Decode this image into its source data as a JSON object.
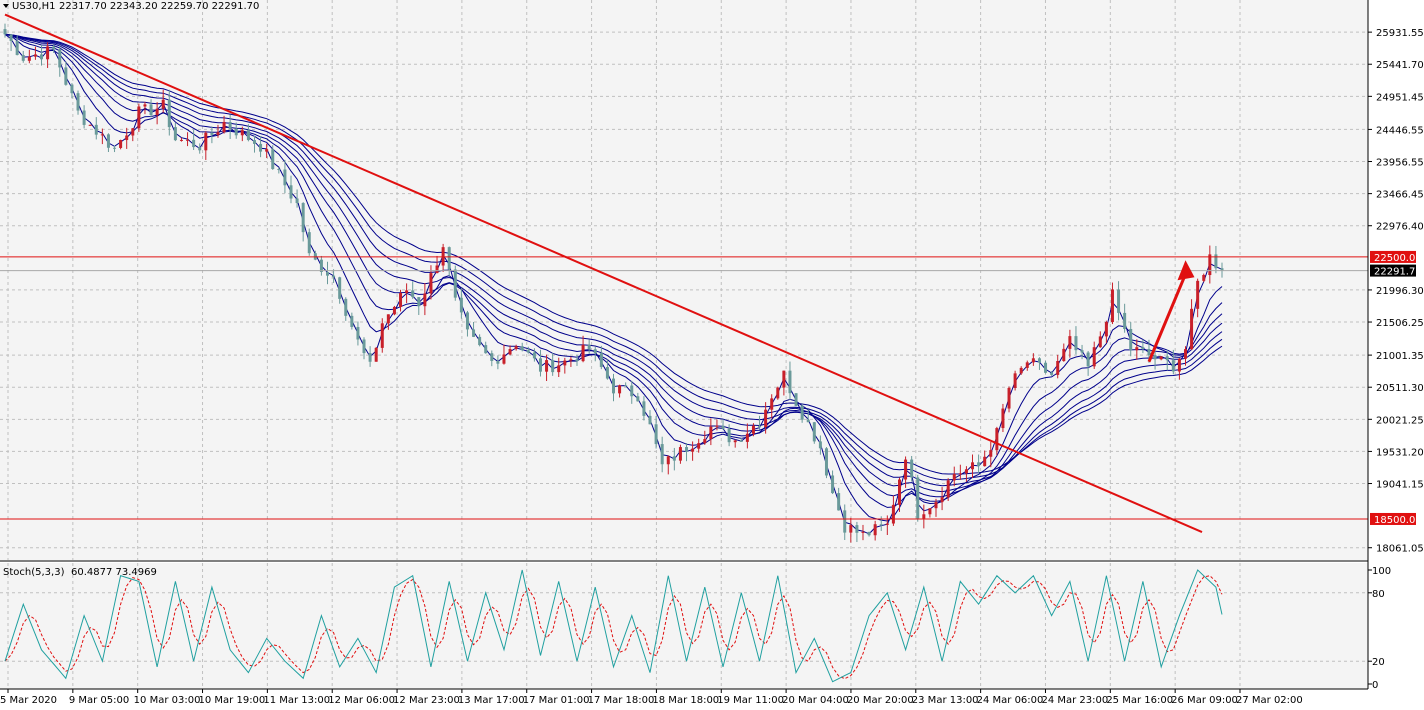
{
  "header": {
    "symbol_label": "US30,H1",
    "ohlc": "22317.70 22343.20 22259.70 22291.70",
    "menu_arrow_icon": "triangle-down-icon"
  },
  "indicator_header": {
    "label": "Stoch(5,3,3)",
    "values": "60.4877 73.4969"
  },
  "colors": {
    "background": "#f4f4f4",
    "grid": "#c0c0c0",
    "bull": "#c8202a",
    "bear": "#6a9a9a",
    "ma": "#00008b",
    "trendline": "#e01010",
    "hline": "#e01010",
    "stoch_main": "#20a0a0",
    "stoch_signal": "#e01010",
    "price_tag_current": "#000000"
  },
  "chart_data": [
    {
      "type": "candlestick",
      "symbol": "US30",
      "timeframe": "H1",
      "y_ticks": [
        "25931.55",
        "25441.70",
        "24951.45",
        "24446.55",
        "23956.55",
        "23466.45",
        "22976.40",
        "21996.30",
        "21506.25",
        "21001.35",
        "20511.30",
        "20021.25",
        "19531.20",
        "19041.15",
        "18061.05"
      ],
      "ylim": [
        17950,
        26300
      ],
      "x_ticks": [
        "5 Mar 2020",
        "9 Mar 05:00",
        "10 Mar 03:00",
        "10 Mar 19:00",
        "11 Mar 13:00",
        "12 Mar 06:00",
        "12 Mar 23:00",
        "13 Mar 17:00",
        "17 Mar 01:00",
        "17 Mar 18:00",
        "18 Mar 18:00",
        "19 Mar 11:00",
        "20 Mar 04:00",
        "20 Mar 20:00",
        "23 Mar 13:00",
        "24 Mar 06:00",
        "24 Mar 23:00",
        "25 Mar 16:00",
        "26 Mar 09:00",
        "27 Mar 02:00"
      ],
      "close_path": [
        [
          0,
          25900
        ],
        [
          3,
          25550
        ],
        [
          8,
          25650
        ],
        [
          12,
          24700
        ],
        [
          18,
          24150
        ],
        [
          22,
          24700
        ],
        [
          26,
          24800
        ],
        [
          28,
          24300
        ],
        [
          32,
          24200
        ],
        [
          36,
          24550
        ],
        [
          42,
          24200
        ],
        [
          48,
          23300
        ],
        [
          50,
          22500
        ],
        [
          54,
          22200
        ],
        [
          58,
          21200
        ],
        [
          60,
          20800
        ],
        [
          62,
          21500
        ],
        [
          66,
          22000
        ],
        [
          68,
          21800
        ],
        [
          70,
          22200
        ],
        [
          72,
          22700
        ],
        [
          74,
          21800
        ],
        [
          76,
          21300
        ],
        [
          80,
          20900
        ],
        [
          84,
          21200
        ],
        [
          88,
          20800
        ],
        [
          92,
          20900
        ],
        [
          96,
          21100
        ],
        [
          100,
          20500
        ],
        [
          104,
          20400
        ],
        [
          106,
          19900
        ],
        [
          108,
          19300
        ],
        [
          112,
          19600
        ],
        [
          116,
          19900
        ],
        [
          120,
          19700
        ],
        [
          124,
          20000
        ],
        [
          126,
          20400
        ],
        [
          128,
          20700
        ],
        [
          130,
          20300
        ],
        [
          134,
          19600
        ],
        [
          136,
          18900
        ],
        [
          138,
          18400
        ],
        [
          141,
          18250
        ],
        [
          145,
          18400
        ],
        [
          148,
          19500
        ],
        [
          150,
          18600
        ],
        [
          153,
          18800
        ],
        [
          156,
          19200
        ],
        [
          160,
          19300
        ],
        [
          163,
          19800
        ],
        [
          165,
          20500
        ],
        [
          168,
          20900
        ],
        [
          172,
          20700
        ],
        [
          175,
          21200
        ],
        [
          178,
          20800
        ],
        [
          180,
          21300
        ],
        [
          182,
          21900
        ],
        [
          185,
          21100
        ],
        [
          188,
          21000
        ],
        [
          190,
          20900
        ],
        [
          192,
          20850
        ],
        [
          194,
          21100
        ],
        [
          196,
          22100
        ],
        [
          198,
          22500
        ],
        [
          200,
          22300
        ]
      ],
      "close": 22291.7,
      "candle_count": 201,
      "trendline": {
        "from": [
          0,
          26200
        ],
        "to": [
          200,
          18300
        ]
      },
      "horizontal_lines": [
        22500,
        18500
      ],
      "price_tags": [
        {
          "label": "22500.00",
          "value": 22500,
          "style": "red"
        },
        {
          "label": "22291.70",
          "value": 22291.7,
          "style": "black"
        },
        {
          "label": "18500.00",
          "value": 18500,
          "style": "red"
        }
      ],
      "arrow": {
        "from": [
          188,
          20900
        ],
        "to": [
          194,
          22450
        ]
      },
      "ma_offsets": [
        0,
        60,
        120,
        180,
        240,
        300,
        380,
        460
      ],
      "grid": true
    },
    {
      "type": "line",
      "name": "Stoch(5,3,3)",
      "ylim": [
        0,
        100
      ],
      "y_ticks": [
        "100",
        "80",
        "20",
        "0"
      ],
      "levels": [
        80,
        20
      ],
      "main_path": [
        [
          0,
          20
        ],
        [
          3,
          70
        ],
        [
          6,
          30
        ],
        [
          10,
          5
        ],
        [
          13,
          60
        ],
        [
          16,
          20
        ],
        [
          19,
          95
        ],
        [
          22,
          90
        ],
        [
          25,
          15
        ],
        [
          28,
          90
        ],
        [
          31,
          20
        ],
        [
          34,
          85
        ],
        [
          37,
          30
        ],
        [
          40,
          10
        ],
        [
          43,
          40
        ],
        [
          46,
          20
        ],
        [
          49,
          5
        ],
        [
          52,
          60
        ],
        [
          55,
          15
        ],
        [
          58,
          40
        ],
        [
          61,
          10
        ],
        [
          64,
          85
        ],
        [
          67,
          95
        ],
        [
          70,
          15
        ],
        [
          73,
          90
        ],
        [
          76,
          20
        ],
        [
          79,
          80
        ],
        [
          82,
          30
        ],
        [
          85,
          100
        ],
        [
          88,
          25
        ],
        [
          91,
          90
        ],
        [
          94,
          20
        ],
        [
          97,
          85
        ],
        [
          100,
          15
        ],
        [
          103,
          60
        ],
        [
          106,
          10
        ],
        [
          109,
          95
        ],
        [
          112,
          20
        ],
        [
          115,
          85
        ],
        [
          118,
          15
        ],
        [
          121,
          80
        ],
        [
          124,
          20
        ],
        [
          127,
          95
        ],
        [
          130,
          10
        ],
        [
          133,
          40
        ],
        [
          136,
          2
        ],
        [
          139,
          10
        ],
        [
          142,
          60
        ],
        [
          145,
          80
        ],
        [
          148,
          30
        ],
        [
          151,
          85
        ],
        [
          154,
          20
        ],
        [
          157,
          90
        ],
        [
          160,
          70
        ],
        [
          163,
          95
        ],
        [
          166,
          80
        ],
        [
          169,
          95
        ],
        [
          172,
          60
        ],
        [
          175,
          90
        ],
        [
          178,
          20
        ],
        [
          181,
          95
        ],
        [
          184,
          20
        ],
        [
          187,
          90
        ],
        [
          190,
          15
        ],
        [
          193,
          60
        ],
        [
          196,
          100
        ],
        [
          199,
          85
        ],
        [
          200,
          61
        ]
      ],
      "signal_lag": 1,
      "values": [
        60.4877,
        73.4969
      ]
    }
  ]
}
